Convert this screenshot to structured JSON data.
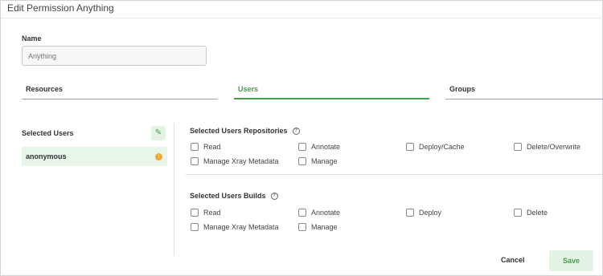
{
  "modal": {
    "title": "Edit Permission Anything"
  },
  "name_field": {
    "label": "Name",
    "placeholder": "Anything"
  },
  "tabs": [
    {
      "label": "Resources",
      "active": false
    },
    {
      "label": "Users",
      "active": true
    },
    {
      "label": "Groups",
      "active": false
    }
  ],
  "selected_users": {
    "title": "Selected Users",
    "edit_icon": "pencil-icon",
    "users": [
      {
        "name": "anonymous",
        "status_icon": "warning-icon"
      }
    ]
  },
  "repositories": {
    "title": "Selected Users Repositories",
    "help_icon": "help-icon",
    "permissions": [
      {
        "label": "Read",
        "checked": false
      },
      {
        "label": "Annotate",
        "checked": false
      },
      {
        "label": "Deploy/Cache",
        "checked": false
      },
      {
        "label": "Delete/Overwrite",
        "checked": false
      },
      {
        "label": "Manage Xray Metadata",
        "checked": false
      },
      {
        "label": "Manage",
        "checked": false
      }
    ]
  },
  "builds": {
    "title": "Selected Users Builds",
    "help_icon": "help-icon",
    "permissions": [
      {
        "label": "Read",
        "checked": false
      },
      {
        "label": "Annotate",
        "checked": false
      },
      {
        "label": "Deploy",
        "checked": false
      },
      {
        "label": "Delete",
        "checked": false
      },
      {
        "label": "Manage Xray Metadata",
        "checked": false
      },
      {
        "label": "Manage",
        "checked": false
      }
    ]
  },
  "footer": {
    "cancel_label": "Cancel",
    "save_label": "Save"
  },
  "colors": {
    "accent": "#43a047",
    "accent_bg": "#e8f5e9",
    "warning": "#f0a830"
  }
}
